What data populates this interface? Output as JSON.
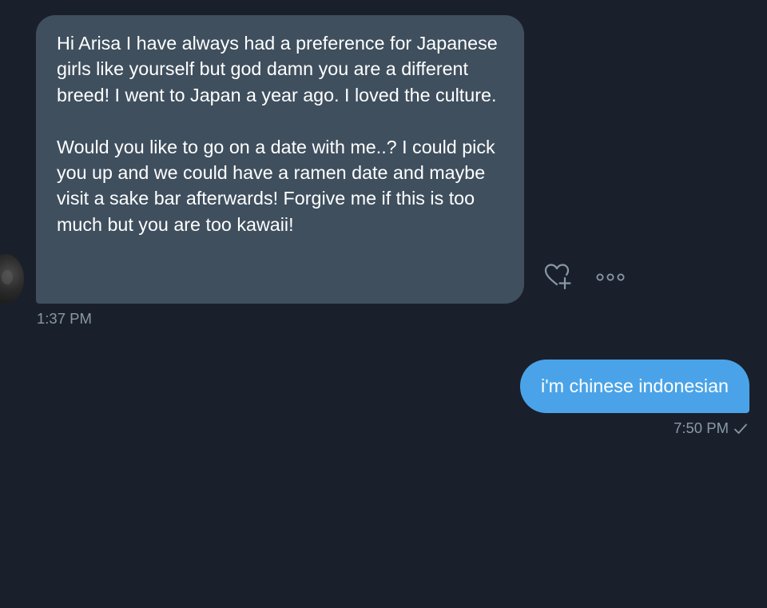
{
  "conversation": {
    "incoming": {
      "paragraphs": [
        "Hi Arisa I have always had a preference for Japanese girls like yourself but god damn you are a different breed! I went to Japan a year ago. I loved the culture.",
        "Would you like to go on a date with me..? I could pick you up and we could have a ramen date and maybe visit a sake bar afterwards! Forgive me if this is too much but you are too kawaii!"
      ],
      "timestamp": "1:37 PM",
      "actions": {
        "like_icon": "heart-plus-icon",
        "more_icon": "more-horizontal-icon"
      }
    },
    "outgoing": {
      "text": "i'm chinese indonesian",
      "timestamp": "7:50 PM",
      "status_icon": "check-icon"
    }
  },
  "colors": {
    "background": "#1a202b",
    "incoming_bubble": "#3f4f5e",
    "outgoing_bubble": "#4aa3e8",
    "timestamp_text": "#8899a6",
    "icon_stroke": "#8899a6"
  }
}
